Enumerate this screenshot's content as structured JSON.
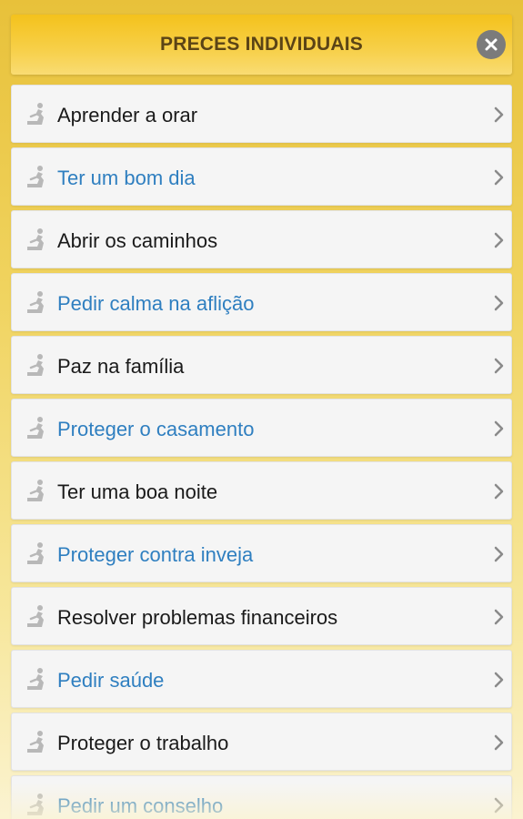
{
  "header": {
    "title": "PRECES INDIVIDUAIS",
    "close_icon": "close-icon"
  },
  "colors": {
    "accent_text": "#2f7fc0",
    "header_bg": "#f4c21c",
    "icon_gray": "#b8b8b8"
  },
  "items": [
    {
      "label": "Aprender a orar",
      "icon": "praying-person-icon"
    },
    {
      "label": "Ter um bom dia",
      "icon": "praying-person-icon"
    },
    {
      "label": "Abrir os caminhos",
      "icon": "praying-person-icon"
    },
    {
      "label": "Pedir calma na aflição",
      "icon": "praying-person-icon"
    },
    {
      "label": "Paz na família",
      "icon": "praying-person-icon"
    },
    {
      "label": "Proteger o casamento",
      "icon": "praying-person-icon"
    },
    {
      "label": "Ter uma boa noite",
      "icon": "praying-person-icon"
    },
    {
      "label": "Proteger contra inveja",
      "icon": "praying-person-icon"
    },
    {
      "label": "Resolver problemas financeiros",
      "icon": "praying-person-icon"
    },
    {
      "label": "Pedir saúde",
      "icon": "praying-person-icon"
    },
    {
      "label": "Proteger o trabalho",
      "icon": "praying-person-icon"
    },
    {
      "label": "Pedir um conselho",
      "icon": "praying-person-icon"
    }
  ]
}
